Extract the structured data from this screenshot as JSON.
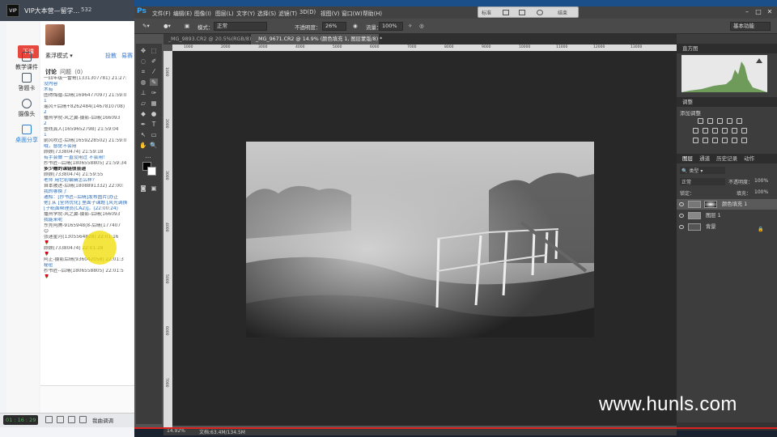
{
  "chat": {
    "title": "VIP大本营—留学...",
    "count": "532",
    "logo": "VIP",
    "side": [
      {
        "label": "下课",
        "icon": "exit-icon"
      },
      {
        "label": "教学课件",
        "icon": "courseware-icon"
      },
      {
        "label": "答题卡",
        "icon": "answer-card-icon"
      },
      {
        "label": "摄像头",
        "icon": "camera-icon"
      },
      {
        "label": "桌面分享",
        "icon": "desktop-share-icon"
      }
    ],
    "mode": "素浮模式 ▾",
    "bind_tab": "投教",
    "more_tab": "易赛",
    "discuss_tab": "讨论",
    "ask_tab": "问题（0）",
    "messages": [
      {
        "text": "一四年级一雷哥(1331307781) 21:27:",
        "style": ""
      },
      {
        "text": "没内容",
        "style": "blue"
      },
      {
        "text": "",
        "style": ""
      },
      {
        "text": "木有",
        "style": "blue"
      },
      {
        "text": "图得悔循-后晴(1696477097) 21:59:0",
        "style": ""
      },
      {
        "text": "1",
        "style": "blue"
      },
      {
        "text": "遥风+后晴+8262484(1467810708)",
        "style": ""
      },
      {
        "text": "2",
        "style": "blue"
      },
      {
        "text": "播州学院-风之翼-摄影-后晴(166093",
        "style": ""
      },
      {
        "text": "2",
        "style": "blue"
      },
      {
        "text": "壹线真人(1659652798) 21:59:04",
        "style": ""
      },
      {
        "text": "1",
        "style": "blue"
      },
      {
        "text": "前风吹过-后晴(1659228502) 21:59:0",
        "style": ""
      },
      {
        "text": "哦，感觉不会用",
        "style": "blue"
      },
      {
        "text": "顾顾(73380474) 21:59:18",
        "style": ""
      },
      {
        "text": "有手会做 一直没用过 不会用！",
        "style": "blue"
      },
      {
        "text": "抄书匠--后晴(1806558805) 21:59:34",
        "style": ""
      },
      {
        "text": "多少赠的课链很会递",
        "style": "dark"
      },
      {
        "text": "顾顾(73380474) 21:59:55",
        "style": ""
      },
      {
        "text": "老师 用它初编辑怎么样？",
        "style": "blue"
      },
      {
        "text": "自本被进-后晴(1808891332) 22:00:",
        "style": ""
      },
      {
        "text": "我的哪换了",
        "style": "blue"
      },
      {
        "text": "通知：[抄书匠--后晴]发布图片(办正",
        "style": "blue"
      },
      {
        "text": "他] 从 [全然优化] 里面子课题 [风光调换",
        "style": "blue"
      },
      {
        "text": "[子纸面帮理员(CA2)]。(22:00:24)",
        "style": "blue"
      },
      {
        "text": "播州学院-风之翼-摄影-后晴(166093",
        "style": ""
      },
      {
        "text": "我能来呢",
        "style": "blue"
      },
      {
        "text": "东莞阿腾-9165948(8-后晴(177407",
        "style": ""
      },
      {
        "text": "😊",
        "style": ""
      },
      {
        "text": "张迷星河(1305564828) 22:01:16",
        "style": ""
      },
      {
        "text": "🌹",
        "style": "red"
      },
      {
        "text": "顾顾(73380474) 22:01:28",
        "style": ""
      },
      {
        "text": "🌹",
        "style": "red"
      },
      {
        "text": "阿正-摄影后晴(936042058) 22:01:3",
        "style": ""
      },
      {
        "text": "秘密",
        "style": "blue"
      },
      {
        "text": "抄书匠--后晴(1806558805) 22:01:5",
        "style": ""
      },
      {
        "text": "🌹",
        "style": "red"
      }
    ],
    "timer": "01 : 16 : 29",
    "live_label": "我曲调调"
  },
  "ps": {
    "logo": "Ps",
    "menu": [
      "文件(F)",
      "编辑(E)",
      "图像(I)",
      "图层(L)",
      "文字(Y)",
      "选择(S)",
      "滤镜(T)",
      "3D(D)",
      "视图(V)",
      "窗口(W)",
      "帮助(H)"
    ],
    "float_left": "标准",
    "float_right": "结束",
    "options": {
      "mode_label": "模式：",
      "mode_value": "正常",
      "opacity_label": "不透明度：",
      "opacity_value": "26%",
      "flow_label": "流量：",
      "flow_value": "100%",
      "workspace": "基本功能"
    },
    "tabs": [
      "_MG_9893.CR2 @ 20.5%(RGB/8) *",
      "_MG_9671.CR2 @ 14.9% (颜色填充 1, 图层蒙版/8) *"
    ],
    "status_zoom": "14.92%",
    "status_doc": "文档:63.4M/134.5M",
    "ruler_top": [
      "1000",
      "2000",
      "3000",
      "4000",
      "5000",
      "6000",
      "7000",
      "8000",
      "9000",
      "10000",
      "11000",
      "12000",
      "13000"
    ],
    "ruler_left": [
      "1000",
      "2000",
      "3000",
      "4000",
      "5000",
      "6000",
      "7000"
    ]
  },
  "panels": {
    "histogram_title": "直方图",
    "adjust_title": "调整",
    "adjust_add": "添加调整",
    "layer_tabs": [
      "图层",
      "通道",
      "历史记录",
      "动作"
    ],
    "kind": "类型",
    "blend": "正常",
    "opacity_label": "不透明度：",
    "opacity_value": "100%",
    "lock_label": "锁定：",
    "fill_label": "填充：",
    "fill_value": "100%",
    "layers": [
      {
        "name": "颜色填充 1",
        "selected": true
      },
      {
        "name": "图层 1",
        "selected": false
      },
      {
        "name": "背景",
        "selected": false
      }
    ]
  },
  "watermark": "www.hunls.com"
}
